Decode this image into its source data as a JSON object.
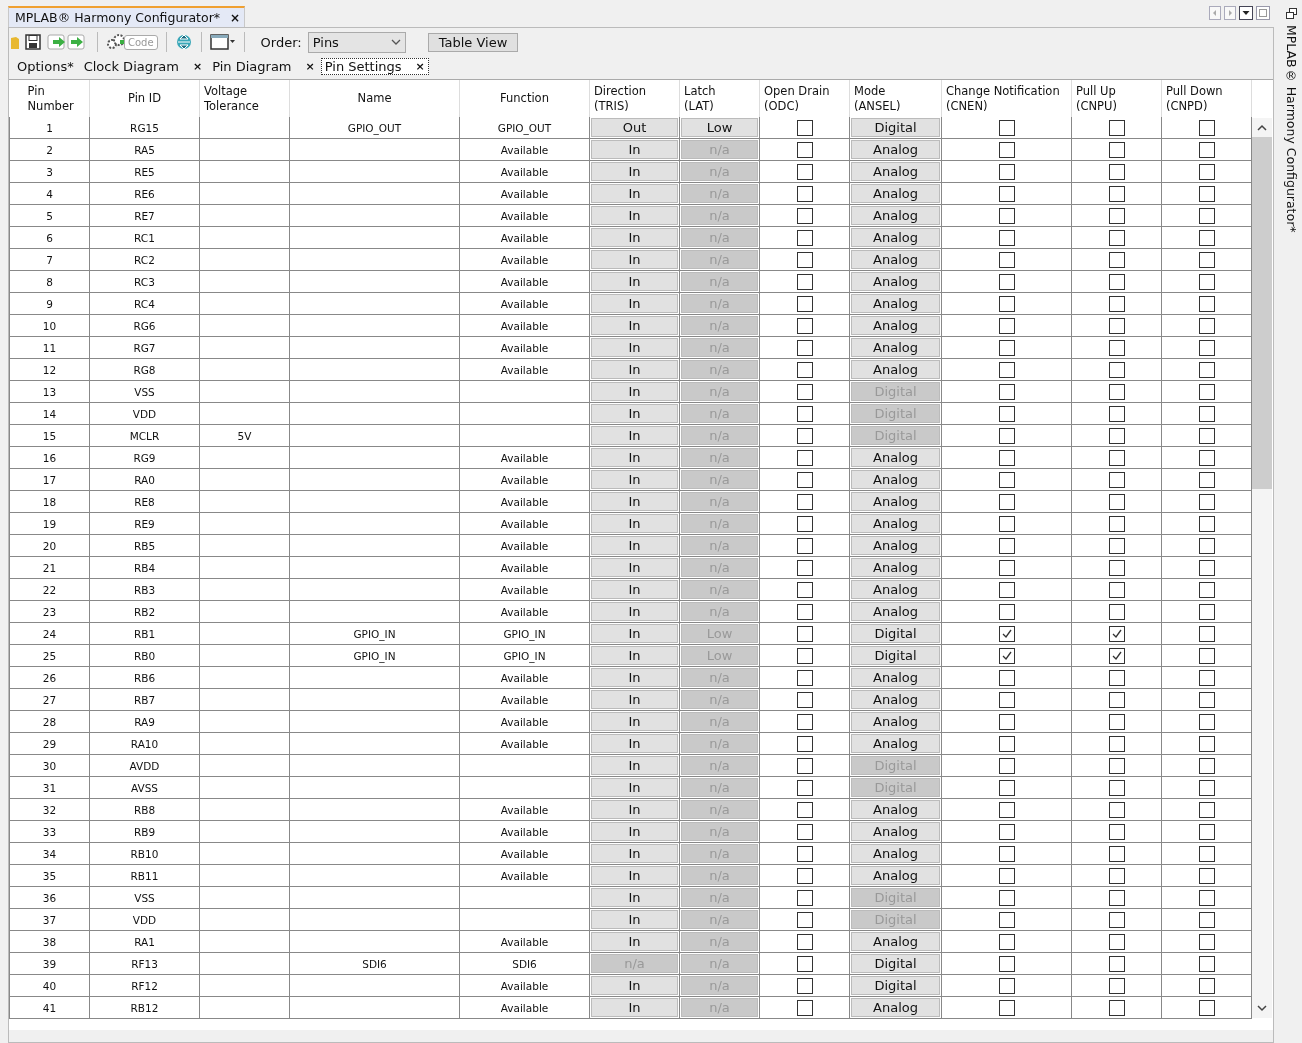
{
  "window": {
    "tab": "MPLAB® Harmony Configurator*",
    "close": "×",
    "side_title": "MPLAB® Harmony Configurator*"
  },
  "toolbar": {
    "code_label": "Code",
    "order_label": "Order:",
    "order_value": "Pins",
    "table_view": "Table View"
  },
  "tabs": [
    {
      "label": "Options*",
      "selected": false
    },
    {
      "label": "Clock Diagram",
      "close": "×",
      "selected": false
    },
    {
      "label": "Pin Diagram",
      "close": "×",
      "selected": false
    },
    {
      "label": "Pin Settings",
      "close": "×",
      "selected": true
    }
  ],
  "table": {
    "columns": [
      "Pin\nNumber",
      "Pin ID",
      "Voltage\nTolerance",
      "Name",
      "Function",
      "Direction\n(TRIS)",
      "Latch\n(LAT)",
      "Open Drain\n(ODC)",
      "Mode\n(ANSEL)",
      "Change Notification\n(CNEN)",
      "Pull Up\n(CNPU)",
      "Pull Down\n(CNPD)"
    ],
    "rows": [
      {
        "pin": "1",
        "pin_id": "RG15",
        "name": "GPIO_OUT",
        "function": "GPIO_OUT",
        "direction": {
          "value": "Out",
          "disabled": false
        },
        "latch": {
          "value": "Low",
          "disabled": false
        },
        "odc": false,
        "mode": {
          "value": "Digital",
          "disabled": false
        },
        "cnen": false,
        "cnpu": false,
        "cnpd": false
      },
      {
        "pin": "2",
        "pin_id": "RA5",
        "function": "Available",
        "direction": {
          "value": "In",
          "disabled": false
        },
        "latch": {
          "value": "n/a",
          "disabled": true
        },
        "odc": false,
        "mode": {
          "value": "Analog",
          "disabled": false
        },
        "cnen": false,
        "cnpu": false,
        "cnpd": false
      },
      {
        "pin": "3",
        "pin_id": "RE5",
        "function": "Available",
        "direction": {
          "value": "In",
          "disabled": false
        },
        "latch": {
          "value": "n/a",
          "disabled": true
        },
        "odc": false,
        "mode": {
          "value": "Analog",
          "disabled": false
        },
        "cnen": false,
        "cnpu": false,
        "cnpd": false
      },
      {
        "pin": "4",
        "pin_id": "RE6",
        "function": "Available",
        "direction": {
          "value": "In",
          "disabled": false
        },
        "latch": {
          "value": "n/a",
          "disabled": true
        },
        "odc": false,
        "mode": {
          "value": "Analog",
          "disabled": false
        },
        "cnen": false,
        "cnpu": false,
        "cnpd": false
      },
      {
        "pin": "5",
        "pin_id": "RE7",
        "function": "Available",
        "direction": {
          "value": "In",
          "disabled": false
        },
        "latch": {
          "value": "n/a",
          "disabled": true
        },
        "odc": false,
        "mode": {
          "value": "Analog",
          "disabled": false
        },
        "cnen": false,
        "cnpu": false,
        "cnpd": false
      },
      {
        "pin": "6",
        "pin_id": "RC1",
        "function": "Available",
        "direction": {
          "value": "In",
          "disabled": false
        },
        "latch": {
          "value": "n/a",
          "disabled": true
        },
        "odc": false,
        "mode": {
          "value": "Analog",
          "disabled": false
        },
        "cnen": false,
        "cnpu": false,
        "cnpd": false
      },
      {
        "pin": "7",
        "pin_id": "RC2",
        "function": "Available",
        "direction": {
          "value": "In",
          "disabled": false
        },
        "latch": {
          "value": "n/a",
          "disabled": true
        },
        "odc": false,
        "mode": {
          "value": "Analog",
          "disabled": false
        },
        "cnen": false,
        "cnpu": false,
        "cnpd": false
      },
      {
        "pin": "8",
        "pin_id": "RC3",
        "function": "Available",
        "direction": {
          "value": "In",
          "disabled": false
        },
        "latch": {
          "value": "n/a",
          "disabled": true
        },
        "odc": false,
        "mode": {
          "value": "Analog",
          "disabled": false
        },
        "cnen": false,
        "cnpu": false,
        "cnpd": false
      },
      {
        "pin": "9",
        "pin_id": "RC4",
        "function": "Available",
        "direction": {
          "value": "In",
          "disabled": false
        },
        "latch": {
          "value": "n/a",
          "disabled": true
        },
        "odc": false,
        "mode": {
          "value": "Analog",
          "disabled": false
        },
        "cnen": false,
        "cnpu": false,
        "cnpd": false
      },
      {
        "pin": "10",
        "pin_id": "RG6",
        "function": "Available",
        "direction": {
          "value": "In",
          "disabled": false
        },
        "latch": {
          "value": "n/a",
          "disabled": true
        },
        "odc": false,
        "mode": {
          "value": "Analog",
          "disabled": false
        },
        "cnen": false,
        "cnpu": false,
        "cnpd": false
      },
      {
        "pin": "11",
        "pin_id": "RG7",
        "function": "Available",
        "direction": {
          "value": "In",
          "disabled": false
        },
        "latch": {
          "value": "n/a",
          "disabled": true
        },
        "odc": false,
        "mode": {
          "value": "Analog",
          "disabled": false
        },
        "cnen": false,
        "cnpu": false,
        "cnpd": false
      },
      {
        "pin": "12",
        "pin_id": "RG8",
        "function": "Available",
        "direction": {
          "value": "In",
          "disabled": false
        },
        "latch": {
          "value": "n/a",
          "disabled": true
        },
        "odc": false,
        "mode": {
          "value": "Analog",
          "disabled": false
        },
        "cnen": false,
        "cnpu": false,
        "cnpd": false
      },
      {
        "pin": "13",
        "pin_id": "VSS",
        "direction": {
          "value": "In",
          "disabled": false
        },
        "latch": {
          "value": "n/a",
          "disabled": true
        },
        "odc": false,
        "mode": {
          "value": "Digital",
          "disabled": true
        },
        "cnen": false,
        "cnpu": false,
        "cnpd": false
      },
      {
        "pin": "14",
        "pin_id": "VDD",
        "direction": {
          "value": "In",
          "disabled": false
        },
        "latch": {
          "value": "n/a",
          "disabled": true
        },
        "odc": false,
        "mode": {
          "value": "Digital",
          "disabled": true
        },
        "cnen": false,
        "cnpu": false,
        "cnpd": false
      },
      {
        "pin": "15",
        "pin_id": "MCLR",
        "voltage": "5V",
        "direction": {
          "value": "In",
          "disabled": false
        },
        "latch": {
          "value": "n/a",
          "disabled": true
        },
        "odc": false,
        "mode": {
          "value": "Digital",
          "disabled": true
        },
        "cnen": false,
        "cnpu": false,
        "cnpd": false
      },
      {
        "pin": "16",
        "pin_id": "RG9",
        "function": "Available",
        "direction": {
          "value": "In",
          "disabled": false
        },
        "latch": {
          "value": "n/a",
          "disabled": true
        },
        "odc": false,
        "mode": {
          "value": "Analog",
          "disabled": false
        },
        "cnen": false,
        "cnpu": false,
        "cnpd": false
      },
      {
        "pin": "17",
        "pin_id": "RA0",
        "function": "Available",
        "direction": {
          "value": "In",
          "disabled": false
        },
        "latch": {
          "value": "n/a",
          "disabled": true
        },
        "odc": false,
        "mode": {
          "value": "Analog",
          "disabled": false
        },
        "cnen": false,
        "cnpu": false,
        "cnpd": false
      },
      {
        "pin": "18",
        "pin_id": "RE8",
        "function": "Available",
        "direction": {
          "value": "In",
          "disabled": false
        },
        "latch": {
          "value": "n/a",
          "disabled": true
        },
        "odc": false,
        "mode": {
          "value": "Analog",
          "disabled": false
        },
        "cnen": false,
        "cnpu": false,
        "cnpd": false
      },
      {
        "pin": "19",
        "pin_id": "RE9",
        "function": "Available",
        "direction": {
          "value": "In",
          "disabled": false
        },
        "latch": {
          "value": "n/a",
          "disabled": true
        },
        "odc": false,
        "mode": {
          "value": "Analog",
          "disabled": false
        },
        "cnen": false,
        "cnpu": false,
        "cnpd": false
      },
      {
        "pin": "20",
        "pin_id": "RB5",
        "function": "Available",
        "direction": {
          "value": "In",
          "disabled": false
        },
        "latch": {
          "value": "n/a",
          "disabled": true
        },
        "odc": false,
        "mode": {
          "value": "Analog",
          "disabled": false
        },
        "cnen": false,
        "cnpu": false,
        "cnpd": false
      },
      {
        "pin": "21",
        "pin_id": "RB4",
        "function": "Available",
        "direction": {
          "value": "In",
          "disabled": false
        },
        "latch": {
          "value": "n/a",
          "disabled": true
        },
        "odc": false,
        "mode": {
          "value": "Analog",
          "disabled": false
        },
        "cnen": false,
        "cnpu": false,
        "cnpd": false
      },
      {
        "pin": "22",
        "pin_id": "RB3",
        "function": "Available",
        "direction": {
          "value": "In",
          "disabled": false
        },
        "latch": {
          "value": "n/a",
          "disabled": true
        },
        "odc": false,
        "mode": {
          "value": "Analog",
          "disabled": false
        },
        "cnen": false,
        "cnpu": false,
        "cnpd": false
      },
      {
        "pin": "23",
        "pin_id": "RB2",
        "function": "Available",
        "direction": {
          "value": "In",
          "disabled": false
        },
        "latch": {
          "value": "n/a",
          "disabled": true
        },
        "odc": false,
        "mode": {
          "value": "Analog",
          "disabled": false
        },
        "cnen": false,
        "cnpu": false,
        "cnpd": false
      },
      {
        "pin": "24",
        "pin_id": "RB1",
        "name": "GPIO_IN",
        "function": "GPIO_IN",
        "direction": {
          "value": "In",
          "disabled": false
        },
        "latch": {
          "value": "Low",
          "disabled": true
        },
        "odc": false,
        "mode": {
          "value": "Digital",
          "disabled": false
        },
        "cnen": true,
        "cnpu": true,
        "cnpd": false
      },
      {
        "pin": "25",
        "pin_id": "RB0",
        "name": "GPIO_IN",
        "function": "GPIO_IN",
        "direction": {
          "value": "In",
          "disabled": false
        },
        "latch": {
          "value": "Low",
          "disabled": true
        },
        "odc": false,
        "mode": {
          "value": "Digital",
          "disabled": false
        },
        "cnen": true,
        "cnpu": true,
        "cnpd": false
      },
      {
        "pin": "26",
        "pin_id": "RB6",
        "function": "Available",
        "direction": {
          "value": "In",
          "disabled": false
        },
        "latch": {
          "value": "n/a",
          "disabled": true
        },
        "odc": false,
        "mode": {
          "value": "Analog",
          "disabled": false
        },
        "cnen": false,
        "cnpu": false,
        "cnpd": false
      },
      {
        "pin": "27",
        "pin_id": "RB7",
        "function": "Available",
        "direction": {
          "value": "In",
          "disabled": false
        },
        "latch": {
          "value": "n/a",
          "disabled": true
        },
        "odc": false,
        "mode": {
          "value": "Analog",
          "disabled": false
        },
        "cnen": false,
        "cnpu": false,
        "cnpd": false
      },
      {
        "pin": "28",
        "pin_id": "RA9",
        "function": "Available",
        "direction": {
          "value": "In",
          "disabled": false
        },
        "latch": {
          "value": "n/a",
          "disabled": true
        },
        "odc": false,
        "mode": {
          "value": "Analog",
          "disabled": false
        },
        "cnen": false,
        "cnpu": false,
        "cnpd": false
      },
      {
        "pin": "29",
        "pin_id": "RA10",
        "function": "Available",
        "direction": {
          "value": "In",
          "disabled": false
        },
        "latch": {
          "value": "n/a",
          "disabled": true
        },
        "odc": false,
        "mode": {
          "value": "Analog",
          "disabled": false
        },
        "cnen": false,
        "cnpu": false,
        "cnpd": false
      },
      {
        "pin": "30",
        "pin_id": "AVDD",
        "direction": {
          "value": "In",
          "disabled": false
        },
        "latch": {
          "value": "n/a",
          "disabled": true
        },
        "odc": false,
        "mode": {
          "value": "Digital",
          "disabled": true
        },
        "cnen": false,
        "cnpu": false,
        "cnpd": false
      },
      {
        "pin": "31",
        "pin_id": "AVSS",
        "direction": {
          "value": "In",
          "disabled": false
        },
        "latch": {
          "value": "n/a",
          "disabled": true
        },
        "odc": false,
        "mode": {
          "value": "Digital",
          "disabled": true
        },
        "cnen": false,
        "cnpu": false,
        "cnpd": false
      },
      {
        "pin": "32",
        "pin_id": "RB8",
        "function": "Available",
        "direction": {
          "value": "In",
          "disabled": false
        },
        "latch": {
          "value": "n/a",
          "disabled": true
        },
        "odc": false,
        "mode": {
          "value": "Analog",
          "disabled": false
        },
        "cnen": false,
        "cnpu": false,
        "cnpd": false
      },
      {
        "pin": "33",
        "pin_id": "RB9",
        "function": "Available",
        "direction": {
          "value": "In",
          "disabled": false
        },
        "latch": {
          "value": "n/a",
          "disabled": true
        },
        "odc": false,
        "mode": {
          "value": "Analog",
          "disabled": false
        },
        "cnen": false,
        "cnpu": false,
        "cnpd": false
      },
      {
        "pin": "34",
        "pin_id": "RB10",
        "function": "Available",
        "direction": {
          "value": "In",
          "disabled": false
        },
        "latch": {
          "value": "n/a",
          "disabled": true
        },
        "odc": false,
        "mode": {
          "value": "Analog",
          "disabled": false
        },
        "cnen": false,
        "cnpu": false,
        "cnpd": false
      },
      {
        "pin": "35",
        "pin_id": "RB11",
        "function": "Available",
        "direction": {
          "value": "In",
          "disabled": false
        },
        "latch": {
          "value": "n/a",
          "disabled": true
        },
        "odc": false,
        "mode": {
          "value": "Analog",
          "disabled": false
        },
        "cnen": false,
        "cnpu": false,
        "cnpd": false
      },
      {
        "pin": "36",
        "pin_id": "VSS",
        "direction": {
          "value": "In",
          "disabled": false
        },
        "latch": {
          "value": "n/a",
          "disabled": true
        },
        "odc": false,
        "mode": {
          "value": "Digital",
          "disabled": true
        },
        "cnen": false,
        "cnpu": false,
        "cnpd": false
      },
      {
        "pin": "37",
        "pin_id": "VDD",
        "direction": {
          "value": "In",
          "disabled": false
        },
        "latch": {
          "value": "n/a",
          "disabled": true
        },
        "odc": false,
        "mode": {
          "value": "Digital",
          "disabled": true
        },
        "cnen": false,
        "cnpu": false,
        "cnpd": false
      },
      {
        "pin": "38",
        "pin_id": "RA1",
        "function": "Available",
        "direction": {
          "value": "In",
          "disabled": false
        },
        "latch": {
          "value": "n/a",
          "disabled": true
        },
        "odc": false,
        "mode": {
          "value": "Analog",
          "disabled": false
        },
        "cnen": false,
        "cnpu": false,
        "cnpd": false
      },
      {
        "pin": "39",
        "pin_id": "RF13",
        "name": "SDI6",
        "function": "SDI6",
        "direction": {
          "value": "n/a",
          "disabled": true
        },
        "latch": {
          "value": "n/a",
          "disabled": true
        },
        "odc": false,
        "mode": {
          "value": "Digital",
          "disabled": false
        },
        "cnen": false,
        "cnpu": false,
        "cnpd": false
      },
      {
        "pin": "40",
        "pin_id": "RF12",
        "function": "Available",
        "direction": {
          "value": "In",
          "disabled": false
        },
        "latch": {
          "value": "n/a",
          "disabled": true
        },
        "odc": false,
        "mode": {
          "value": "Digital",
          "disabled": false
        },
        "cnen": false,
        "cnpu": false,
        "cnpd": false
      },
      {
        "pin": "41",
        "pin_id": "RB12",
        "function": "Available",
        "direction": {
          "value": "In",
          "disabled": false
        },
        "latch": {
          "value": "n/a",
          "disabled": true
        },
        "odc": false,
        "mode": {
          "value": "Analog",
          "disabled": false
        },
        "cnen": false,
        "cnpu": false,
        "cnpd": false
      }
    ]
  }
}
